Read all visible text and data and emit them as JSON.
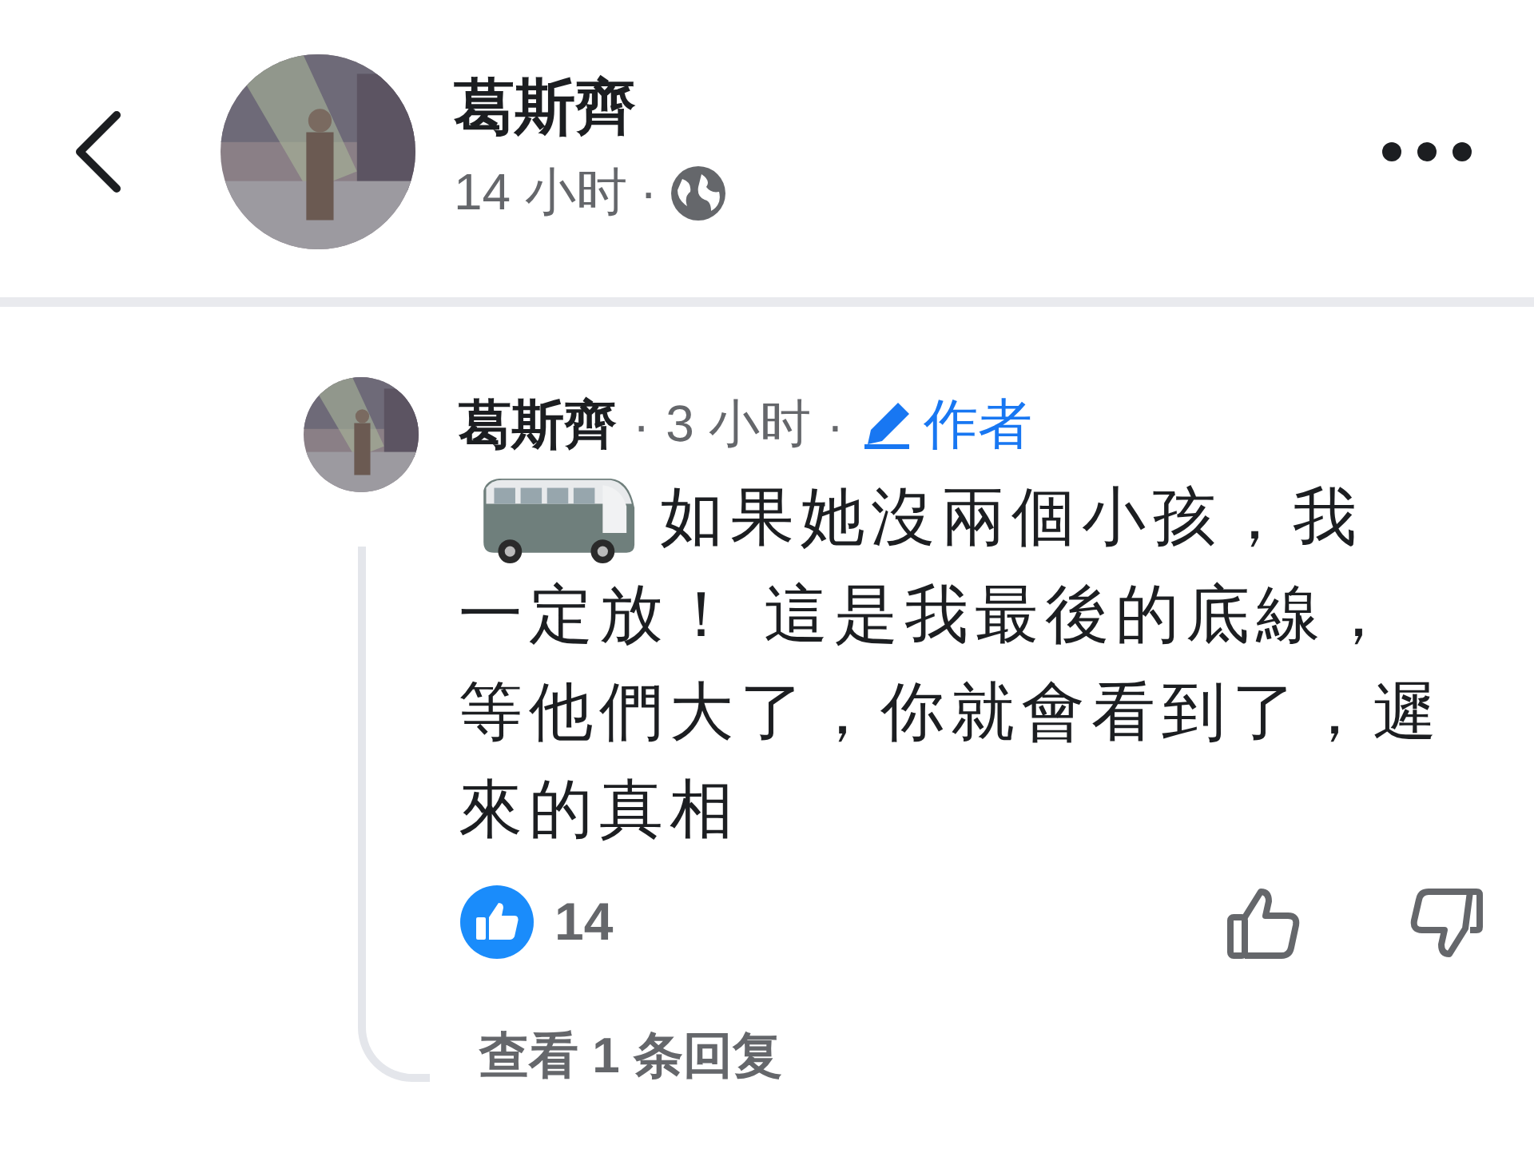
{
  "post_header": {
    "author": "葛斯齊",
    "time": "14 小时",
    "separator": "·"
  },
  "comment": {
    "author": "葛斯齊",
    "separator_1": "·",
    "time": "3 小时",
    "separator_2": "·",
    "badge": "作者",
    "body_lines": [
      "如果她沒兩個小孩，我",
      "一定放！ 這是我最後的底線，",
      "等他們大了，你就會看到了，遲",
      "來的真相"
    ],
    "reaction_count": "14",
    "liked": false,
    "disliked": false,
    "replies_link": "查看 1 条回复"
  }
}
